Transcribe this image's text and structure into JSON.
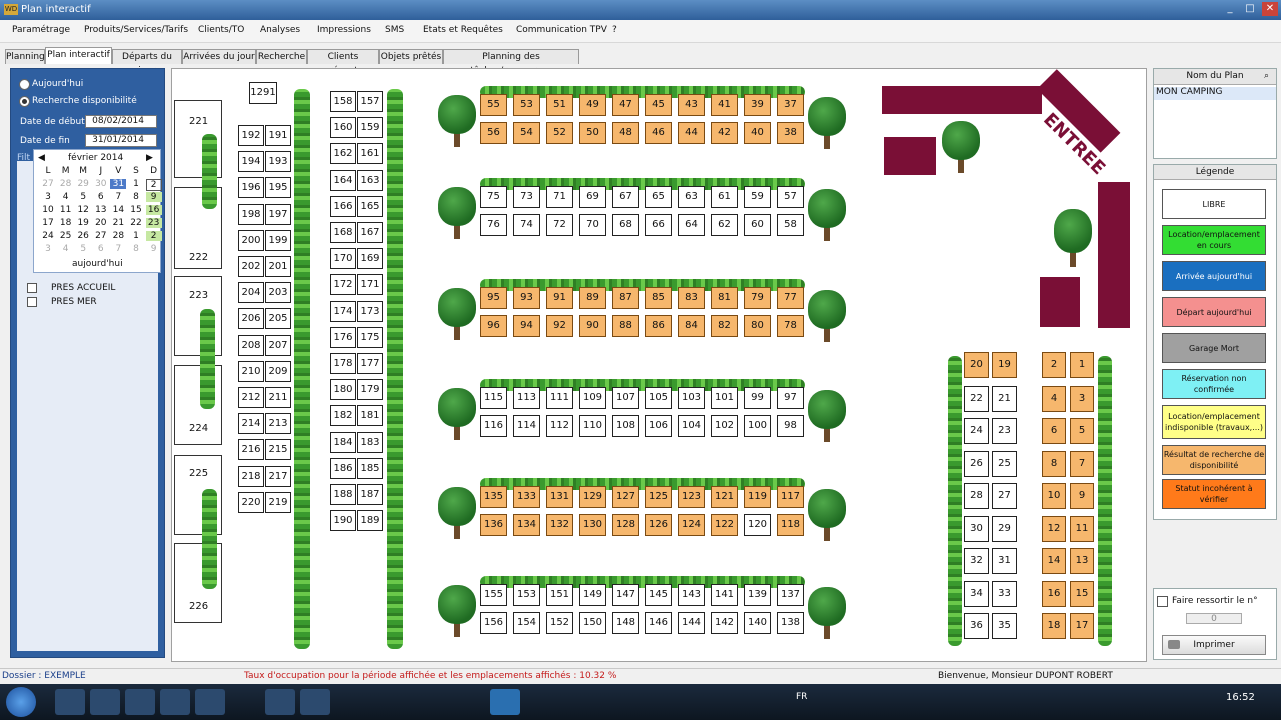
{
  "window": {
    "icon_text": "WD",
    "title": "Plan interactif",
    "buttons": [
      "_",
      "□",
      "✕"
    ]
  },
  "menu": [
    "Paramétrage",
    "Produits/Services/Tarifs",
    "Clients/TO",
    "Analyses",
    "Impressions",
    "SMS",
    "Etats et Requêtes",
    "Communication TPV",
    "?"
  ],
  "tabs": [
    "Planning",
    "Plan interactif",
    "Départs du jour",
    "Arrivées du jour",
    "Recherche",
    "Clients présents",
    "Objets prêtés",
    "Planning des tâches/ressources"
  ],
  "left": {
    "radio_today": "Aujourd'hui",
    "radio_search": "Recherche disponibilité",
    "start_label": "Date de début",
    "start_value": "08/02/2014",
    "end_label": "Date de fin",
    "end_value": "31/01/2014",
    "filter_label": "Filt",
    "calendar": {
      "month": "février 2014",
      "prev": "◀",
      "next": "▶",
      "weekdays": [
        "L",
        "M",
        "M",
        "J",
        "V",
        "S",
        "D"
      ],
      "rows": [
        [
          "27",
          "28",
          "29",
          "30",
          "31",
          "1",
          "2"
        ],
        [
          "3",
          "4",
          "5",
          "6",
          "7",
          "8",
          "9"
        ],
        [
          "10",
          "11",
          "12",
          "13",
          "14",
          "15",
          "16"
        ],
        [
          "17",
          "18",
          "19",
          "20",
          "21",
          "22",
          "23"
        ],
        [
          "24",
          "25",
          "26",
          "27",
          "28",
          "1",
          "2"
        ],
        [
          "3",
          "4",
          "5",
          "6",
          "7",
          "8",
          "9"
        ]
      ],
      "today_button": "aujourd'hui"
    },
    "checkboxes": [
      "PRES ACCUEIL",
      "PRES MER"
    ]
  },
  "plan": {
    "entree": "ENTREE",
    "col_a": [
      "1291",
      "192",
      "191",
      "194",
      "193",
      "196",
      "195",
      "198",
      "197",
      "200",
      "199",
      "202",
      "201",
      "204",
      "203",
      "206",
      "205",
      "208",
      "207",
      "210",
      "209",
      "212",
      "211",
      "214",
      "213",
      "216",
      "215",
      "218",
      "217",
      "220",
      "219"
    ],
    "bigblocks": [
      "221",
      "222",
      "223",
      "224",
      "225",
      "226"
    ],
    "col_b": [
      "158",
      "157",
      "160",
      "159",
      "162",
      "161",
      "164",
      "163",
      "166",
      "165",
      "168",
      "167",
      "170",
      "169",
      "172",
      "171",
      "174",
      "173",
      "176",
      "175",
      "178",
      "177",
      "180",
      "179",
      "182",
      "181",
      "184",
      "183",
      "186",
      "185",
      "188",
      "187",
      "190",
      "189"
    ],
    "rows": [
      {
        "top": [
          "55",
          "53",
          "51",
          "49",
          "47",
          "45",
          "43",
          "41",
          "39",
          "37"
        ],
        "bottom": [
          "56",
          "54",
          "52",
          "50",
          "48",
          "46",
          "44",
          "42",
          "40",
          "38"
        ]
      },
      {
        "top": [
          "75",
          "73",
          "71",
          "69",
          "67",
          "65",
          "63",
          "61",
          "59",
          "57"
        ],
        "bottom": [
          "76",
          "74",
          "72",
          "70",
          "68",
          "66",
          "64",
          "62",
          "60",
          "58"
        ]
      },
      {
        "top": [
          "95",
          "93",
          "91",
          "89",
          "87",
          "85",
          "83",
          "81",
          "79",
          "77"
        ],
        "bottom": [
          "96",
          "94",
          "92",
          "90",
          "88",
          "86",
          "84",
          "82",
          "80",
          "78"
        ]
      },
      {
        "top": [
          "115",
          "113",
          "111",
          "109",
          "107",
          "105",
          "103",
          "101",
          "99",
          "97"
        ],
        "bottom": [
          "116",
          "114",
          "112",
          "110",
          "108",
          "106",
          "104",
          "102",
          "100",
          "98"
        ]
      },
      {
        "top": [
          "135",
          "133",
          "131",
          "129",
          "127",
          "125",
          "123",
          "121",
          "119",
          "117"
        ],
        "bottom": [
          "136",
          "134",
          "132",
          "130",
          "128",
          "126",
          "124",
          "122",
          "120",
          "118"
        ]
      },
      {
        "top": [
          "155",
          "153",
          "151",
          "149",
          "147",
          "145",
          "143",
          "141",
          "139",
          "137"
        ],
        "bottom": [
          "156",
          "154",
          "152",
          "150",
          "148",
          "146",
          "144",
          "142",
          "140",
          "138"
        ]
      }
    ],
    "col_c": [
      "20",
      "19",
      "22",
      "21",
      "24",
      "23",
      "26",
      "25",
      "28",
      "27",
      "30",
      "29",
      "32",
      "31",
      "34",
      "33",
      "36",
      "35"
    ],
    "col_d": [
      "2",
      "1",
      "4",
      "3",
      "6",
      "5",
      "8",
      "7",
      "10",
      "9",
      "12",
      "11",
      "14",
      "13",
      "16",
      "15",
      "18",
      "17"
    ]
  },
  "right": {
    "plan_header": "Nom du Plan",
    "plan_item": "MON CAMPING",
    "legend_title": "Légende",
    "legend": [
      {
        "label": "LIBRE",
        "color": "#ffffff",
        "text_color": "#111111"
      },
      {
        "label": "Location/emplacement en cours",
        "color": "#33dd33",
        "text_color": "#111111"
      },
      {
        "label": "Arrivée aujourd'hui",
        "color": "#1a6fc0",
        "text_color": "#ffffff"
      },
      {
        "label": "Départ aujourd'hui",
        "color": "#f4908f",
        "text_color": "#111111"
      },
      {
        "label": "Garage Mort",
        "color": "#a0a0a0",
        "text_color": "#111111"
      },
      {
        "label": "Réservation non confirmée",
        "color": "#7ef0f4",
        "text_color": "#111111"
      },
      {
        "label": "Location/emplacement indisponible (travaux,...)",
        "color": "#ffff88",
        "text_color": "#111111"
      },
      {
        "label": "Résultat de recherche de disponibilité",
        "color": "#f6b76d",
        "text_color": "#111111"
      },
      {
        "label": "Statut incohérent à vérifier",
        "color": "#ff7a1a",
        "text_color": "#111111"
      }
    ],
    "highlight_label": "Faire ressortir le n°",
    "highlight_value": "0",
    "print_button": "Imprimer"
  },
  "status": {
    "dossier": "Dossier : EXEMPLE",
    "occupation": "Taux d'occupation pour la période affichée et les emplacements affichés : 10.32 %",
    "welcome": "Bienvenue, Monsieur DUPONT ROBERT"
  },
  "taskbar": {
    "lang": "FR",
    "clock": "16:52"
  },
  "colors": {
    "orange_lot": "#f6b76d",
    "road": "#7a0f36",
    "title_blue": "#2f5f9a"
  }
}
